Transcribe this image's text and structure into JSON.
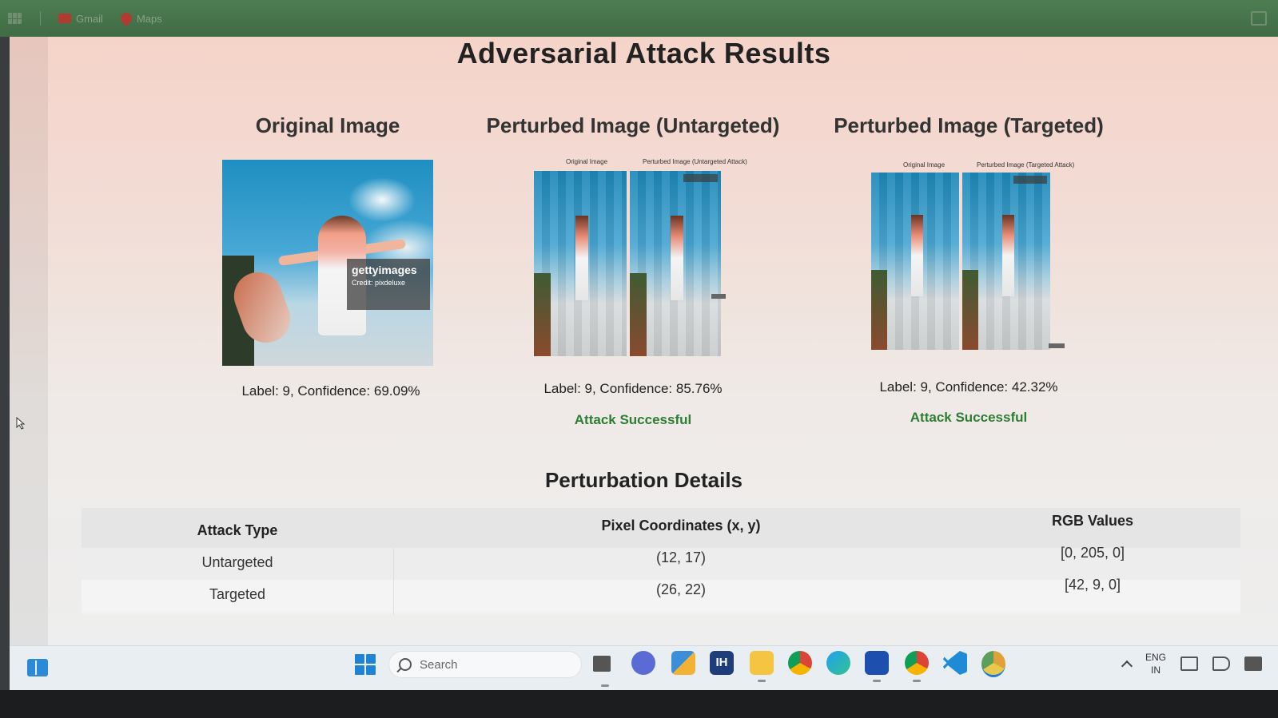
{
  "browser": {
    "bookmarks": [
      {
        "label": "Gmail",
        "icon": "gmail-icon",
        "color": "#c0392b"
      },
      {
        "label": "Maps",
        "icon": "maps-icon",
        "color": "#c0392b"
      }
    ]
  },
  "page": {
    "title": "Adversarial Attack Results",
    "columns": [
      {
        "heading": "Original Image",
        "label": "Label: 9, Confidence: 69.09%",
        "image_watermark": "gettyimages",
        "image_credit": "Credit: pixdeluxe"
      },
      {
        "heading": "Perturbed Image (Untargeted)",
        "caption_left": "Original Image",
        "caption_right": "Perturbed Image (Untargeted Attack)",
        "label": "Label: 9, Confidence: 85.76%",
        "status": "Attack Successful"
      },
      {
        "heading": "Perturbed Image (Targeted)",
        "caption_left": "Original Image",
        "caption_right": "Perturbed Image (Targeted Attack)",
        "label": "Label: 9, Confidence: 42.32%",
        "status": "Attack Successful"
      }
    ],
    "details": {
      "title": "Perturbation Details",
      "headers": [
        "Attack Type",
        "Pixel Coordinates (x, y)",
        "RGB Values"
      ],
      "rows": [
        [
          "Untargeted",
          "(12, 17)",
          "[0, 205, 0]"
        ],
        [
          "Targeted",
          "(26, 22)",
          "[42, 9, 0]"
        ]
      ]
    },
    "status_color": "#2e7d32"
  },
  "taskbar": {
    "search_placeholder": "Search",
    "pinned": [
      "file-explorer-icon",
      "teams-icon",
      "store-icon",
      "ih-icon",
      "folder-icon",
      "chrome-icon",
      "edge-icon",
      "webex-icon",
      "chrome-profile-icon",
      "vscode-icon",
      "chrome-canary-icon"
    ],
    "ih_label": "IH",
    "lang_top": "ENG",
    "lang_bottom": "IN"
  }
}
